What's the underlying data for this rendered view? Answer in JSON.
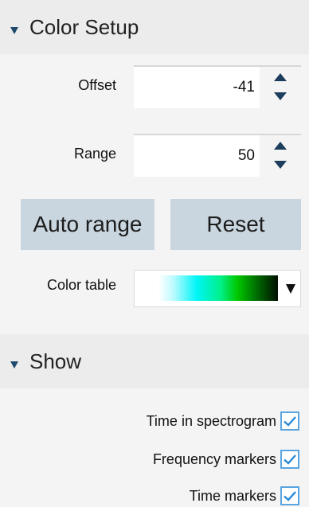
{
  "color_setup": {
    "title": "Color Setup",
    "offset": {
      "label": "Offset",
      "value": "-41"
    },
    "range": {
      "label": "Range",
      "value": "50"
    },
    "auto_range_label": "Auto range",
    "reset_label": "Reset",
    "color_table": {
      "label": "Color table",
      "selected": "white-cyan-green-black gradient"
    }
  },
  "show": {
    "title": "Show",
    "items": [
      {
        "label": "Time in spectrogram",
        "checked": true
      },
      {
        "label": "Frequency markers",
        "checked": true
      },
      {
        "label": "Time markers",
        "checked": true
      }
    ]
  },
  "colors": {
    "header_bg": "#ececec",
    "panel_bg": "#f4f4f4",
    "button_bg": "#c9d6df",
    "arrow": "#1d3d5c",
    "checkbox_border": "#5aa5e0",
    "check": "#2b8ad6"
  }
}
